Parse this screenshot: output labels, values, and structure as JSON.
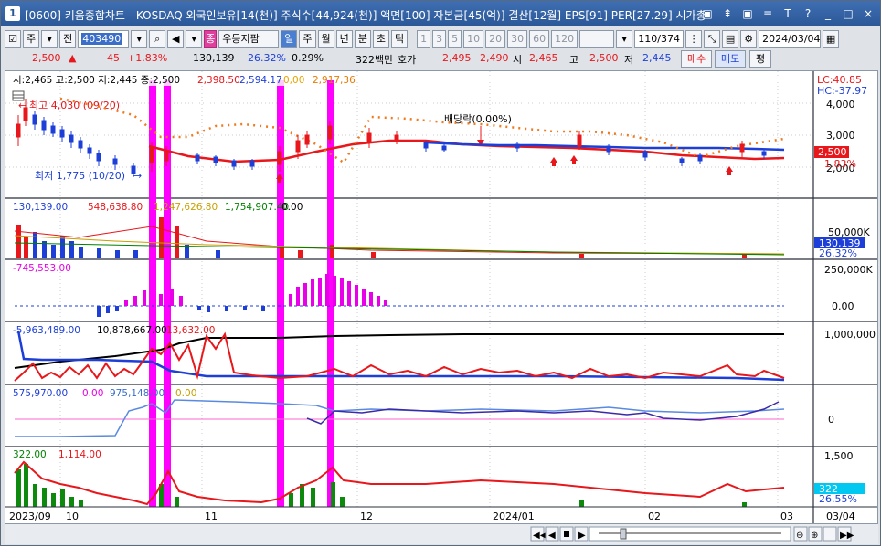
{
  "window": {
    "number": "1",
    "title": "[0600] 키움종합차트 - KOSDAQ 외국인보유[14(천)] 주식수[44,924(천)] 액면[100] 자본금[45(억)] 결산[12월] EPS[91] PER[27.29] 시가총",
    "buttons": [
      "▣",
      "⇞",
      "▣",
      "≡",
      "T",
      "?",
      "_",
      "□",
      "×"
    ]
  },
  "toolbar": {
    "type1": "주",
    "type2": "전",
    "stock_code": "403490",
    "indicator_label": "우등지팜",
    "periods": [
      "일",
      "주",
      "월",
      "년",
      "분",
      "초",
      "틱"
    ],
    "period_selected": "일",
    "intervals": [
      "1",
      "3",
      "5",
      "10",
      "20",
      "30",
      "60",
      "120"
    ],
    "page_display": "110/374",
    "date": "2024/03/04"
  },
  "quote": {
    "price": "2,500",
    "arrow": "▲",
    "change": "45",
    "change_pct": "+1.83%",
    "volume": "130,139",
    "vol_ratio": "26.32%",
    "turnover_pct": "0.29%",
    "amount": "322백만",
    "hoga_label": "호가",
    "ask": "2,495",
    "bid": "2,490",
    "open_label": "시",
    "open": "2,465",
    "high_label": "고",
    "high": "2,500",
    "low_label": "저",
    "low": "2,445",
    "buy_label": "매수",
    "sell_label": "매도",
    "flat_label": "평"
  },
  "price_panel": {
    "header": "시:2,465 고:2,500 저:2,445 종:2,500",
    "ma_values": [
      "2,398.50",
      "2,594.17",
      "0,00",
      "2,917,36"
    ],
    "lc": "LC:40.85",
    "hc": "HC:-37.97",
    "axis": [
      "4,000",
      "3,000",
      "2,000"
    ],
    "current_price_tag": "2,500",
    "pct_tag": "1.83%",
    "high_mark": "최고 4,030 (09/20)",
    "low_mark": "최저 1,775 (10/20)",
    "dividend_mark": "배당락(0.00%)"
  },
  "volume_panel": {
    "header": [
      "130,139.00",
      "548,638.80",
      "1,247,626.80",
      "1,754,907.40",
      "0.00"
    ],
    "axis": [
      "50,000K"
    ],
    "value_tag": "130,139",
    "pct_tag": "26.32%"
  },
  "panel3": {
    "header": "-745,553.00",
    "axis": [
      "250,000K",
      "0.00"
    ]
  },
  "panel4": {
    "header": [
      "-5,963,489.00",
      "10,878,667.00",
      "13,632.00"
    ],
    "axis": [
      "1,000,000"
    ]
  },
  "panel5": {
    "header": [
      "575,970.00",
      "0.00",
      "975,148.00",
      "0.00"
    ],
    "axis": [
      "0"
    ]
  },
  "panel6": {
    "header": [
      "322.00",
      "1,114.00"
    ],
    "axis": [
      "1,500"
    ],
    "value_tag": "322",
    "pct_tag": "26.55%"
  },
  "x_axis": {
    "labels": [
      "2023/09",
      "10",
      "11",
      "12",
      "2024/01",
      "02",
      "03",
      "03/04"
    ]
  },
  "colors": {
    "up": "#e8171b",
    "down": "#1d3fd8",
    "highlight": "#ff00ff",
    "titlebar": "#2b5797"
  }
}
